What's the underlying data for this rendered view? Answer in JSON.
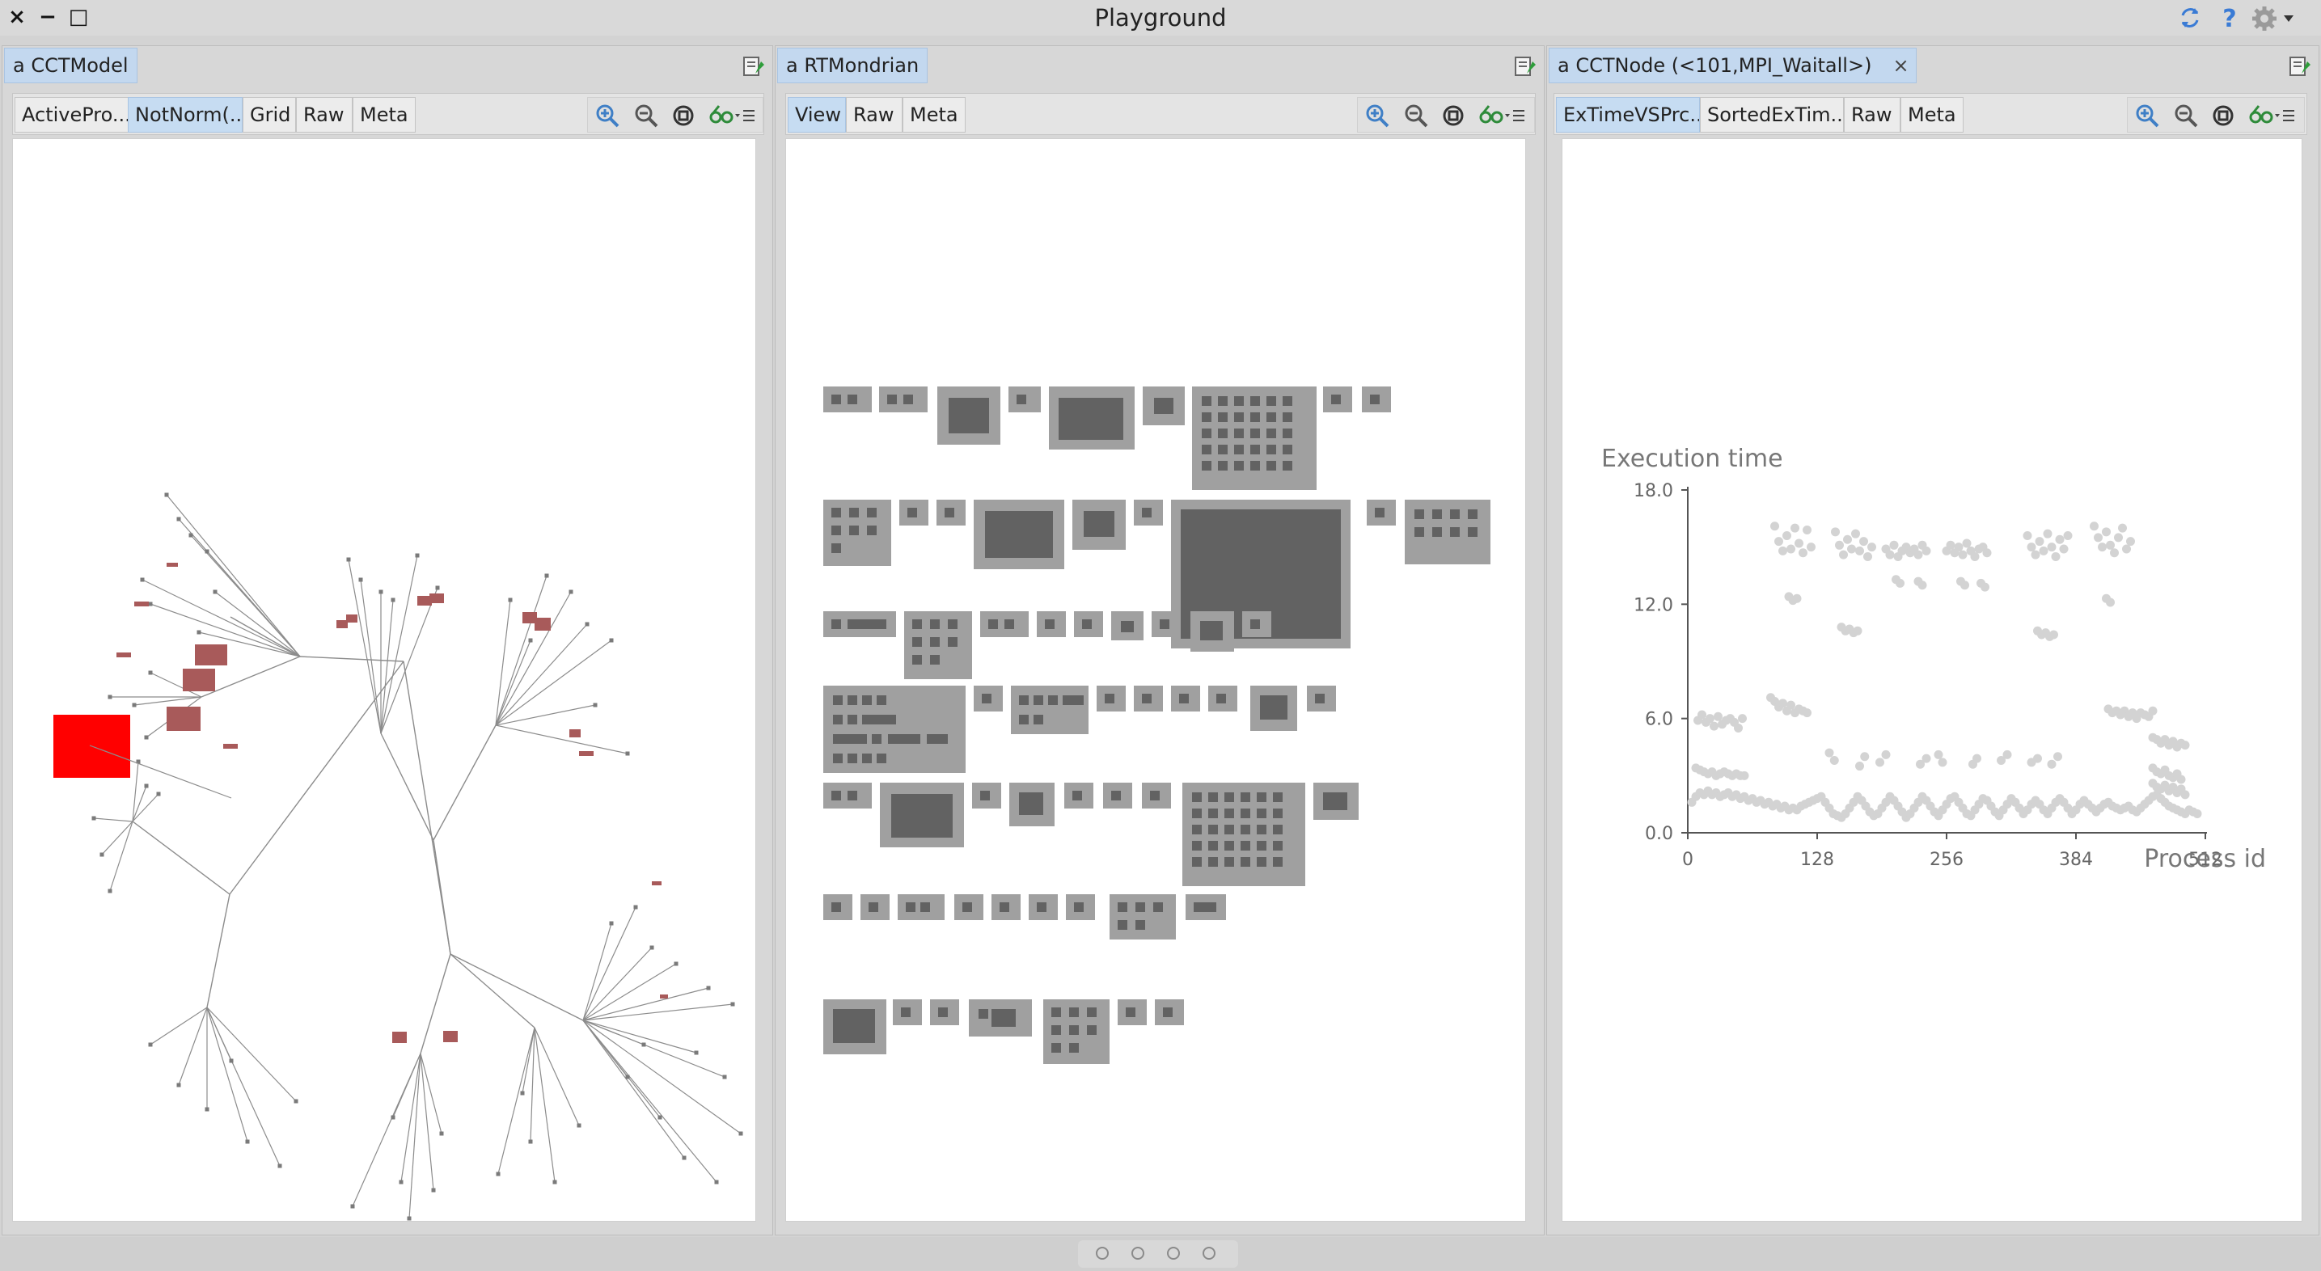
{
  "window": {
    "title": "Playground",
    "controls": {
      "close": "×",
      "minimize": "−",
      "maximize": "□"
    },
    "right_icons": [
      "refresh-icon",
      "help-icon",
      "gear-icon"
    ]
  },
  "panels": [
    {
      "tab_title": "a CCTModel",
      "view_tabs": [
        {
          "label": "ActivePro...",
          "active": false
        },
        {
          "label": "NotNorm(...",
          "active": true
        },
        {
          "label": "Grid",
          "active": false
        },
        {
          "label": "Raw",
          "active": false
        },
        {
          "label": "Meta",
          "active": false
        }
      ]
    },
    {
      "tab_title": "a RTMondrian",
      "view_tabs": [
        {
          "label": "View",
          "active": true
        },
        {
          "label": "Raw",
          "active": false
        },
        {
          "label": "Meta",
          "active": false
        }
      ]
    },
    {
      "tab_title": "a CCTNode (<101,MPI_Waitall>)",
      "tab_close": "×",
      "view_tabs": [
        {
          "label": "ExTimeVSPrc...",
          "active": true
        },
        {
          "label": "SortedExTim...",
          "active": false
        },
        {
          "label": "Raw",
          "active": false
        },
        {
          "label": "Meta",
          "active": false
        }
      ]
    }
  ],
  "toolbar_icons": [
    "zoom-in-icon",
    "zoom-out-icon",
    "zoom-fit-icon",
    "inspect-icon",
    "menu-icon"
  ],
  "colors": {
    "selection_tab": "#c6dcf2",
    "tree_edge": "#8c8c8c",
    "hotspot_max": "#ff0000",
    "hotspot": "#a85a5a",
    "mondrian_outer": "#a0a0a0",
    "mondrian_inner": "#626262",
    "scatter_point": "#d3d3d3"
  },
  "chart_data": {
    "type": "scatter",
    "title": "",
    "ylabel": "Execution time",
    "xlabel": "Process id",
    "xlim": [
      0,
      512
    ],
    "ylim": [
      0,
      18
    ],
    "x_ticks": [
      "0",
      "128",
      "256",
      "384",
      "512"
    ],
    "y_ticks": [
      "0.0",
      "6.0",
      "12.0",
      "18.0"
    ],
    "series": [
      {
        "points": [
          [
            4,
            1.6
          ],
          [
            8,
            1.9
          ],
          [
            12,
            2.1
          ],
          [
            16,
            2.0
          ],
          [
            20,
            2.2
          ],
          [
            24,
            2.0
          ],
          [
            28,
            2.1
          ],
          [
            32,
            1.9
          ],
          [
            36,
            2.0
          ],
          [
            40,
            2.1
          ],
          [
            44,
            1.9
          ],
          [
            48,
            2.0
          ],
          [
            52,
            1.8
          ],
          [
            56,
            1.9
          ],
          [
            60,
            1.7
          ],
          [
            64,
            1.8
          ],
          [
            68,
            1.6
          ],
          [
            72,
            1.7
          ],
          [
            76,
            1.5
          ],
          [
            80,
            1.6
          ],
          [
            84,
            1.4
          ],
          [
            88,
            1.5
          ],
          [
            92,
            1.3
          ],
          [
            96,
            1.4
          ],
          [
            100,
            1.2
          ],
          [
            104,
            1.3
          ],
          [
            108,
            1.2
          ],
          [
            112,
            1.4
          ],
          [
            116,
            1.5
          ],
          [
            120,
            1.6
          ],
          [
            124,
            1.7
          ],
          [
            128,
            1.8
          ],
          [
            132,
            1.9
          ],
          [
            136,
            1.6
          ],
          [
            140,
            1.3
          ],
          [
            144,
            1.0
          ],
          [
            148,
            0.9
          ],
          [
            152,
            0.8
          ],
          [
            156,
            1.0
          ],
          [
            160,
            1.3
          ],
          [
            164,
            1.6
          ],
          [
            168,
            1.9
          ],
          [
            172,
            1.7
          ],
          [
            176,
            1.4
          ],
          [
            180,
            1.1
          ],
          [
            184,
            0.9
          ],
          [
            188,
            1.0
          ],
          [
            192,
            1.3
          ],
          [
            196,
            1.6
          ],
          [
            200,
            1.9
          ],
          [
            204,
            1.7
          ],
          [
            208,
            1.4
          ],
          [
            212,
            1.1
          ],
          [
            216,
            0.8
          ],
          [
            220,
            1.0
          ],
          [
            224,
            1.3
          ],
          [
            228,
            1.6
          ],
          [
            232,
            1.9
          ],
          [
            236,
            1.7
          ],
          [
            240,
            1.4
          ],
          [
            244,
            1.1
          ],
          [
            248,
            0.9
          ],
          [
            252,
            1.2
          ],
          [
            256,
            1.5
          ],
          [
            260,
            1.8
          ],
          [
            264,
            1.9
          ],
          [
            268,
            1.6
          ],
          [
            272,
            1.3
          ],
          [
            276,
            1.0
          ],
          [
            280,
            0.9
          ],
          [
            284,
            1.2
          ],
          [
            288,
            1.5
          ],
          [
            292,
            1.8
          ],
          [
            296,
            1.7
          ],
          [
            300,
            1.4
          ],
          [
            304,
            1.1
          ],
          [
            308,
            0.9
          ],
          [
            312,
            1.2
          ],
          [
            316,
            1.5
          ],
          [
            320,
            1.8
          ],
          [
            324,
            1.6
          ],
          [
            328,
            1.3
          ],
          [
            332,
            1.0
          ],
          [
            336,
            1.2
          ],
          [
            340,
            1.5
          ],
          [
            344,
            1.7
          ],
          [
            348,
            1.5
          ],
          [
            352,
            1.2
          ],
          [
            356,
            1.0
          ],
          [
            360,
            1.3
          ],
          [
            364,
            1.6
          ],
          [
            368,
            1.8
          ],
          [
            372,
            1.6
          ],
          [
            376,
            1.3
          ],
          [
            380,
            1.0
          ],
          [
            384,
            1.2
          ],
          [
            388,
            1.5
          ],
          [
            392,
            1.7
          ],
          [
            396,
            1.5
          ],
          [
            400,
            1.3
          ],
          [
            404,
            1.1
          ],
          [
            408,
            1.3
          ],
          [
            412,
            1.5
          ],
          [
            416,
            1.6
          ],
          [
            420,
            1.4
          ],
          [
            424,
            1.3
          ],
          [
            428,
            1.2
          ],
          [
            432,
            1.3
          ],
          [
            436,
            1.4
          ],
          [
            440,
            1.2
          ],
          [
            444,
            1.1
          ],
          [
            448,
            1.3
          ],
          [
            452,
            1.5
          ],
          [
            456,
            1.7
          ],
          [
            460,
            1.9
          ],
          [
            464,
            2.0
          ],
          [
            468,
            1.8
          ],
          [
            472,
            1.6
          ],
          [
            476,
            1.4
          ],
          [
            480,
            1.3
          ],
          [
            484,
            1.2
          ],
          [
            488,
            1.1
          ],
          [
            492,
            1.0
          ],
          [
            496,
            1.2
          ],
          [
            500,
            1.1
          ],
          [
            504,
            1.0
          ],
          [
            8,
            3.4
          ],
          [
            12,
            3.3
          ],
          [
            16,
            3.2
          ],
          [
            20,
            3.1
          ],
          [
            24,
            3.2
          ],
          [
            28,
            3.0
          ],
          [
            32,
            3.1
          ],
          [
            36,
            3.2
          ],
          [
            40,
            3.1
          ],
          [
            44,
            3.0
          ],
          [
            48,
            3.1
          ],
          [
            52,
            3.0
          ],
          [
            56,
            3.0
          ],
          [
            10,
            5.9
          ],
          [
            14,
            6.2
          ],
          [
            18,
            5.8
          ],
          [
            22,
            6.0
          ],
          [
            26,
            5.6
          ],
          [
            30,
            6.1
          ],
          [
            34,
            5.7
          ],
          [
            38,
            5.9
          ],
          [
            42,
            6.0
          ],
          [
            46,
            5.8
          ],
          [
            50,
            5.5
          ],
          [
            54,
            6.0
          ],
          [
            82,
            7.1
          ],
          [
            86,
            6.9
          ],
          [
            90,
            6.6
          ],
          [
            94,
            6.8
          ],
          [
            98,
            6.4
          ],
          [
            102,
            6.7
          ],
          [
            106,
            6.3
          ],
          [
            110,
            6.5
          ],
          [
            114,
            6.4
          ],
          [
            118,
            6.3
          ],
          [
            416,
            6.5
          ],
          [
            420,
            6.3
          ],
          [
            424,
            6.4
          ],
          [
            428,
            6.2
          ],
          [
            432,
            6.4
          ],
          [
            436,
            6.1
          ],
          [
            440,
            6.3
          ],
          [
            444,
            6.0
          ],
          [
            448,
            6.3
          ],
          [
            452,
            6.2
          ],
          [
            456,
            6.1
          ],
          [
            460,
            6.4
          ],
          [
            460,
            5.0
          ],
          [
            464,
            4.9
          ],
          [
            468,
            4.7
          ],
          [
            472,
            4.9
          ],
          [
            476,
            4.6
          ],
          [
            480,
            4.8
          ],
          [
            484,
            4.5
          ],
          [
            488,
            4.7
          ],
          [
            492,
            4.6
          ],
          [
            460,
            3.4
          ],
          [
            464,
            3.2
          ],
          [
            468,
            3.1
          ],
          [
            472,
            3.3
          ],
          [
            476,
            3.0
          ],
          [
            480,
            2.9
          ],
          [
            484,
            3.1
          ],
          [
            488,
            2.8
          ],
          [
            460,
            2.6
          ],
          [
            464,
            2.4
          ],
          [
            468,
            2.3
          ],
          [
            472,
            2.5
          ],
          [
            476,
            2.2
          ],
          [
            480,
            2.4
          ],
          [
            484,
            2.1
          ],
          [
            488,
            2.3
          ],
          [
            492,
            2.0
          ],
          [
            140,
            4.2
          ],
          [
            145,
            3.8
          ],
          [
            170,
            3.5
          ],
          [
            175,
            4.0
          ],
          [
            190,
            3.7
          ],
          [
            196,
            4.1
          ],
          [
            230,
            3.6
          ],
          [
            236,
            3.9
          ],
          [
            248,
            4.1
          ],
          [
            252,
            3.7
          ],
          [
            282,
            3.6
          ],
          [
            286,
            3.9
          ],
          [
            310,
            3.8
          ],
          [
            316,
            4.1
          ],
          [
            340,
            3.7
          ],
          [
            346,
            3.9
          ],
          [
            360,
            3.6
          ],
          [
            366,
            4.0
          ],
          [
            86,
            16.1
          ],
          [
            90,
            15.3
          ],
          [
            94,
            14.8
          ],
          [
            98,
            15.6
          ],
          [
            102,
            14.9
          ],
          [
            106,
            16.0
          ],
          [
            110,
            15.2
          ],
          [
            114,
            14.7
          ],
          [
            118,
            15.9
          ],
          [
            122,
            15.0
          ],
          [
            100,
            12.4
          ],
          [
            104,
            12.2
          ],
          [
            108,
            12.3
          ],
          [
            146,
            15.8
          ],
          [
            150,
            15.1
          ],
          [
            154,
            14.6
          ],
          [
            158,
            15.4
          ],
          [
            162,
            14.9
          ],
          [
            166,
            15.7
          ],
          [
            170,
            14.8
          ],
          [
            174,
            15.3
          ],
          [
            178,
            14.5
          ],
          [
            182,
            15.0
          ],
          [
            152,
            10.8
          ],
          [
            156,
            10.6
          ],
          [
            160,
            10.7
          ],
          [
            164,
            10.5
          ],
          [
            168,
            10.6
          ],
          [
            196,
            14.9
          ],
          [
            200,
            14.6
          ],
          [
            204,
            15.1
          ],
          [
            208,
            14.5
          ],
          [
            212,
            14.8
          ],
          [
            216,
            15.0
          ],
          [
            220,
            14.7
          ],
          [
            224,
            14.9
          ],
          [
            228,
            14.6
          ],
          [
            232,
            15.1
          ],
          [
            236,
            14.8
          ],
          [
            206,
            13.3
          ],
          [
            210,
            13.1
          ],
          [
            228,
            13.2
          ],
          [
            232,
            13.0
          ],
          [
            256,
            14.8
          ],
          [
            260,
            15.1
          ],
          [
            264,
            14.7
          ],
          [
            268,
            15.0
          ],
          [
            272,
            14.6
          ],
          [
            276,
            15.2
          ],
          [
            280,
            14.8
          ],
          [
            284,
            14.5
          ],
          [
            288,
            14.9
          ],
          [
            292,
            15.0
          ],
          [
            296,
            14.7
          ],
          [
            270,
            13.2
          ],
          [
            274,
            13.0
          ],
          [
            290,
            13.1
          ],
          [
            294,
            12.9
          ],
          [
            336,
            15.6
          ],
          [
            340,
            15.0
          ],
          [
            344,
            14.6
          ],
          [
            348,
            15.3
          ],
          [
            352,
            14.8
          ],
          [
            356,
            15.7
          ],
          [
            360,
            15.0
          ],
          [
            364,
            14.5
          ],
          [
            368,
            15.4
          ],
          [
            372,
            14.9
          ],
          [
            376,
            15.6
          ],
          [
            346,
            10.6
          ],
          [
            350,
            10.4
          ],
          [
            354,
            10.5
          ],
          [
            358,
            10.3
          ],
          [
            362,
            10.4
          ],
          [
            402,
            16.1
          ],
          [
            406,
            15.5
          ],
          [
            410,
            15.0
          ],
          [
            414,
            15.8
          ],
          [
            418,
            15.1
          ],
          [
            422,
            14.7
          ],
          [
            426,
            15.5
          ],
          [
            430,
            16.0
          ],
          [
            434,
            14.9
          ],
          [
            438,
            15.3
          ],
          [
            414,
            12.3
          ],
          [
            418,
            12.1
          ]
        ]
      }
    ]
  }
}
